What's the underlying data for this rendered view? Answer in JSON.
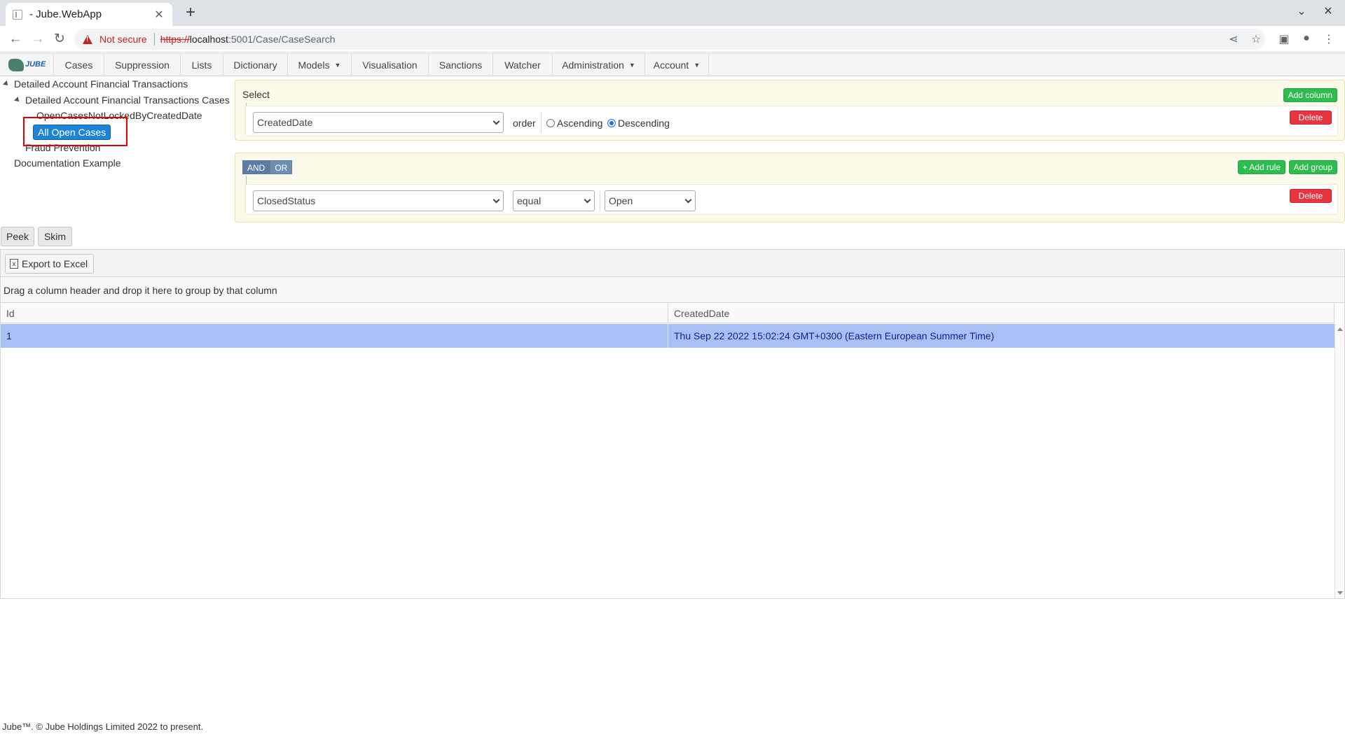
{
  "browser": {
    "tab_title": "- Jube.WebApp",
    "not_secure": "Not secure",
    "url_scheme": "https://",
    "url_host": "localhost",
    "url_path": ":5001/Case/CaseSearch"
  },
  "nav": {
    "items": [
      {
        "label": "Cases"
      },
      {
        "label": "Suppression"
      },
      {
        "label": "Lists"
      },
      {
        "label": "Dictionary"
      },
      {
        "label": "Models"
      },
      {
        "label": "Visualisation"
      },
      {
        "label": "Sanctions"
      },
      {
        "label": "Watcher"
      },
      {
        "label": "Administration"
      },
      {
        "label": "Account"
      }
    ],
    "logo_text": "JUBE"
  },
  "tree": {
    "root1": "Detailed Account Financial Transactions",
    "child1": "Detailed Account Financial Transactions Cases",
    "leaf1": "OpenCasesNotLockedByCreatedDate",
    "leaf2_selected": "All Open Cases",
    "child2": "Fraud Prevention",
    "root2": "Documentation Example"
  },
  "select_panel": {
    "title": "Select",
    "add_column": "Add column",
    "field": "CreatedDate",
    "order_label": "order",
    "ascending": "Ascending",
    "descending": "Descending",
    "order_selected": "Descending",
    "delete": "Delete"
  },
  "rule_panel": {
    "and": "AND",
    "or": "OR",
    "add_rule": "+ Add rule",
    "add_group": "Add group",
    "field": "ClosedStatus",
    "operator": "equal",
    "value": "Open",
    "delete": "Delete"
  },
  "actions": {
    "peek": "Peek",
    "skim": "Skim"
  },
  "grid": {
    "export": "Export to Excel",
    "group_hint": "Drag a column header and drop it here to group by that column",
    "columns": [
      "Id",
      "CreatedDate"
    ],
    "rows": [
      {
        "id": "1",
        "created": "Thu Sep 22 2022 15:02:24 GMT+0300 (Eastern European Summer Time)"
      }
    ]
  },
  "footer": "Jube™. © Jube Holdings Limited 2022 to present."
}
